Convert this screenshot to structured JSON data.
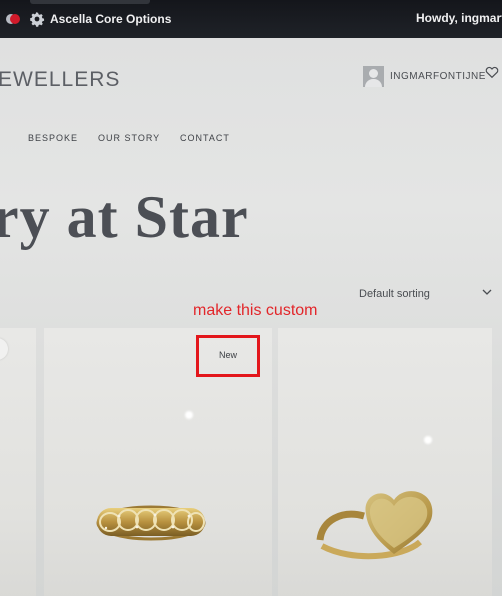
{
  "adminbar": {
    "options_label": "Ascella Core Options",
    "greeting": "Howdy, ingmarfontijne"
  },
  "header": {
    "logo_text": "EWELLERS",
    "username": "INGMARFONTIJNE"
  },
  "nav": {
    "items": [
      "BESPOKE",
      "OUR STORY",
      "CONTACT"
    ]
  },
  "hero": {
    "title_fragment": "ry at Star"
  },
  "catalog": {
    "sorting_selected": "Default sorting",
    "badge_label": "New"
  },
  "annotation": {
    "text": "make this custom",
    "color": "#e2262a"
  },
  "icons": {
    "settings": "gear-icon",
    "user": "avatar-icon",
    "wishlist": "heart-icon",
    "dropdown": "chevron-down-icon"
  }
}
